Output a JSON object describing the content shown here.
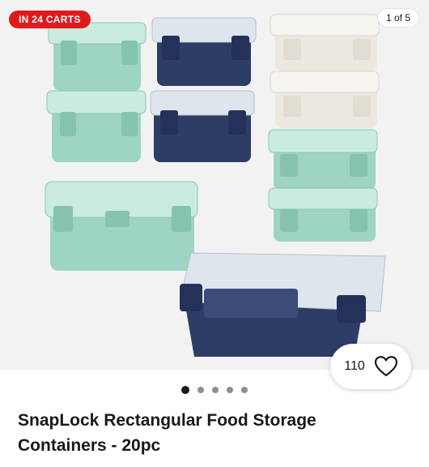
{
  "listing": {
    "cart_badge": "IN 24 CARTS",
    "image_counter": "1 of 5",
    "watch_count": "110",
    "title": "SnapLock Rectangular Food Storage Containers - 20pc",
    "gallery": {
      "images_total": 5,
      "current_index": 1
    }
  },
  "icons": {
    "watch": "heart-outline-icon"
  },
  "colors": {
    "badge_bg": "#e0191c",
    "mint": "#9fd6c4",
    "navy": "#2e3d66",
    "cream": "#ece8e0",
    "dot_active": "#191919",
    "dot_inactive": "#8f8f8f"
  }
}
